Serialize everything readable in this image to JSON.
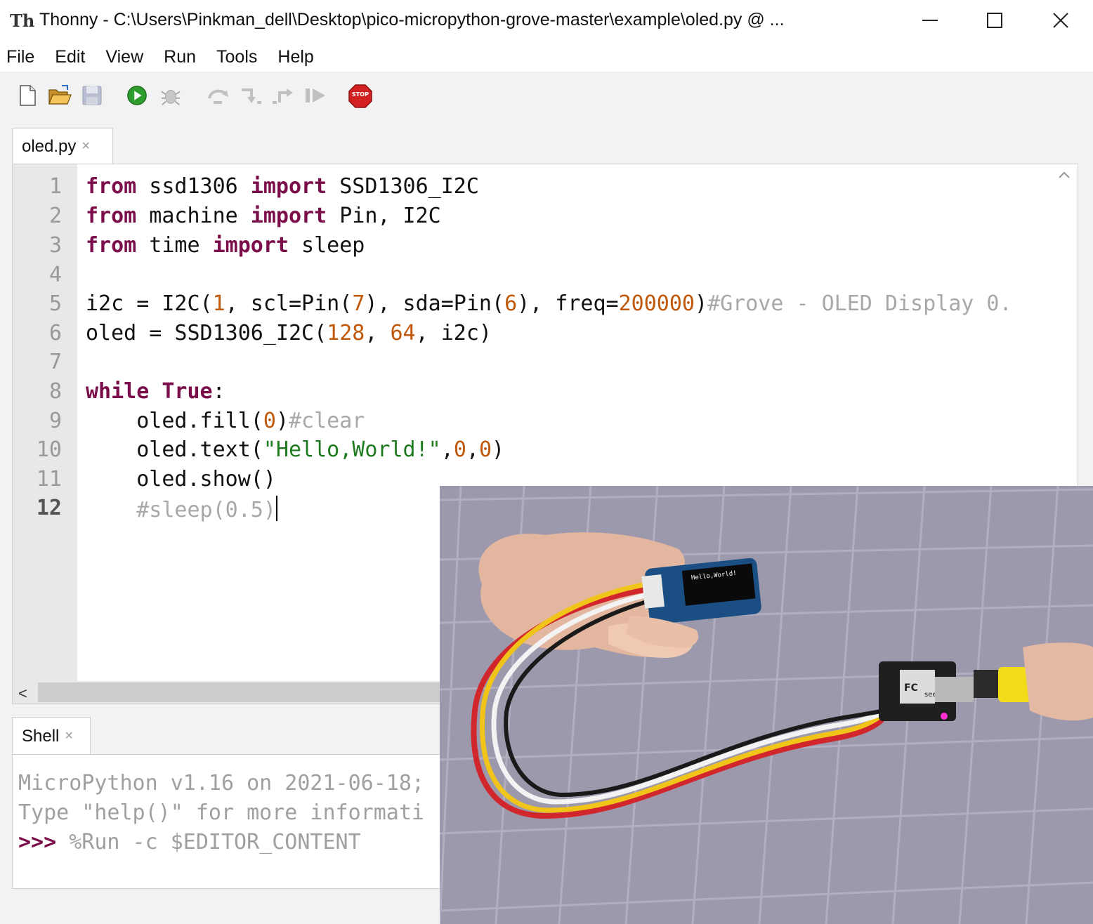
{
  "window": {
    "app_name": "Thonny",
    "title": "Thonny  -  C:\\Users\\Pinkman_dell\\Desktop\\pico-micropython-grove-master\\example\\oled.py  @  ...",
    "minimize_icon": "minimize-icon",
    "maximize_icon": "maximize-icon",
    "close_icon": "close-icon"
  },
  "menu": {
    "items": [
      "File",
      "Edit",
      "View",
      "Run",
      "Tools",
      "Help"
    ]
  },
  "toolbar": {
    "icons": [
      "new-file-icon",
      "open-file-icon",
      "save-icon",
      "run-icon",
      "debug-icon",
      "step-over-icon",
      "step-into-icon",
      "step-out-icon",
      "resume-icon",
      "stop-icon"
    ],
    "stop_label": "STOP",
    "colors": {
      "run": "#2e9d2e",
      "stop": "#d32020"
    }
  },
  "editor": {
    "tab_label": "oled.py",
    "tab_close": "×",
    "line_numbers": [
      "1",
      "2",
      "3",
      "4",
      "5",
      "6",
      "7",
      "8",
      "9",
      "10",
      "11",
      "12"
    ],
    "current_line": "12",
    "lines": [
      {
        "text": "from ssd1306 import SSD1306_I2C"
      },
      {
        "text": "from machine import Pin, I2C"
      },
      {
        "text": "from time import sleep"
      },
      {
        "text": ""
      },
      {
        "text": "i2c = I2C(1, scl=Pin(7), sda=Pin(6), freq=200000)#Grove - OLED Display 0."
      },
      {
        "text": "oled = SSD1306_I2C(128, 64, i2c)"
      },
      {
        "text": ""
      },
      {
        "text": "while True:"
      },
      {
        "text": "    oled.fill(0)#clear"
      },
      {
        "text": "    oled.text(\"Hello,World!\",0,0)"
      },
      {
        "text": "    oled.show()"
      },
      {
        "text": "    #sleep(0.5)"
      }
    ],
    "tokens": {
      "l1": [
        "from",
        " ssd1306 ",
        "import",
        " SSD1306_I2C"
      ],
      "l2": [
        "from",
        " machine ",
        "import",
        " Pin, I2C"
      ],
      "l3": [
        "from",
        " time ",
        "import",
        " sleep"
      ],
      "l5": [
        "i2c = I2C(",
        "1",
        ", scl=Pin(",
        "7",
        "), sda=Pin(",
        "6",
        "), freq=",
        "200000",
        ")",
        "#Grove - OLED Display 0."
      ],
      "l6": [
        "oled = SSD1306_I2C(",
        "128",
        ", ",
        "64",
        ", i2c)"
      ],
      "l8": [
        "while",
        " ",
        "True",
        ":"
      ],
      "l9": [
        "    oled.fill(",
        "0",
        ")",
        "#clear"
      ],
      "l10": [
        "    oled.text(",
        "\"Hello,World!\"",
        ",",
        "0",
        ",",
        "0",
        ")"
      ],
      "l11": [
        "    oled.show()"
      ],
      "l12": [
        "    ",
        "#sleep(0.5)"
      ]
    },
    "syntax_colors": {
      "keyword": "#7b0d4b",
      "number": "#c0580a",
      "string": "#1e7a1e",
      "comment": "#a8a8a8"
    }
  },
  "shell": {
    "tab_label": "Shell",
    "tab_close": "×",
    "line1": "MicroPython v1.16 on 2021-06-18;",
    "line2": "Type \"help()\" for more informati",
    "prompt": ">>>",
    "command": " %Run -c $EDITOR_CONTENT"
  },
  "photo": {
    "oled_screen_text": "Hello,World!",
    "board_brand": "seeed",
    "board_marking": "FC"
  }
}
